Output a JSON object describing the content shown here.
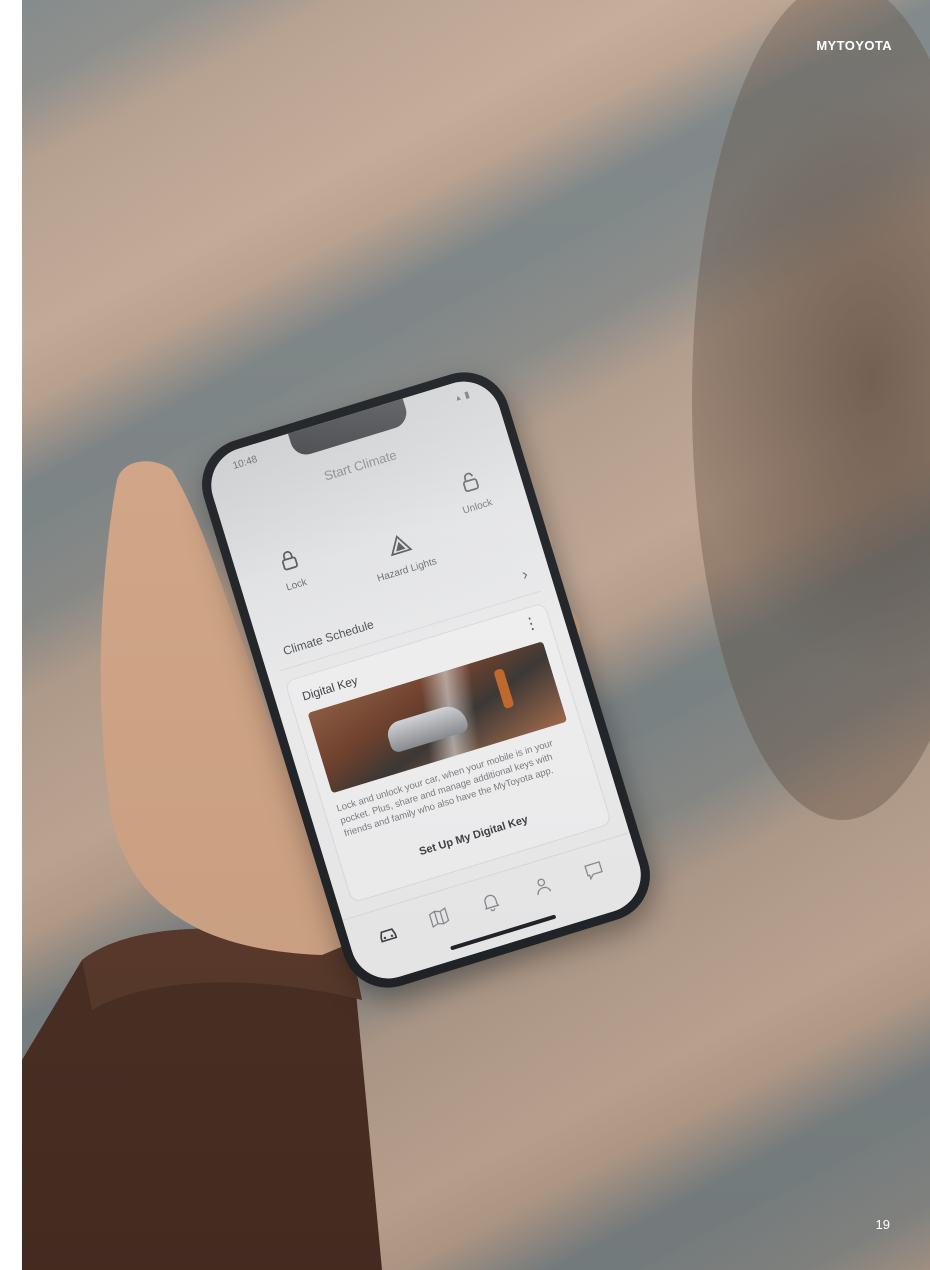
{
  "header": {
    "brand": "MYTOYOTA"
  },
  "footer": {
    "page_number": "19"
  },
  "phone": {
    "status": {
      "time": "10:48"
    },
    "screen_title": "Start Climate",
    "controls": [
      {
        "label": "Lock",
        "icon": "lock-icon"
      },
      {
        "label": "Hazard Lights",
        "icon": "hazard-icon"
      },
      {
        "label": "Unlock",
        "icon": "unlock-icon"
      }
    ],
    "climate_schedule": {
      "label": "Climate Schedule",
      "chevron": "›"
    },
    "digital_key": {
      "title": "Digital Key",
      "more": "⋮",
      "description": "Lock and unlock your car, when your mobile is in your pocket. Plus, share and manage additional keys with friends and family who also have the MyToyota app.",
      "cta": "Set Up My Digital Key"
    },
    "tabbar": [
      {
        "icon": "car-icon"
      },
      {
        "icon": "map-icon"
      },
      {
        "icon": "bell-icon"
      },
      {
        "icon": "person-icon"
      },
      {
        "icon": "chat-icon"
      }
    ]
  },
  "colors": {
    "text_light": "#ffffff",
    "phone_frame": "#1f2226",
    "screen_bg": "#f2f2f3"
  }
}
